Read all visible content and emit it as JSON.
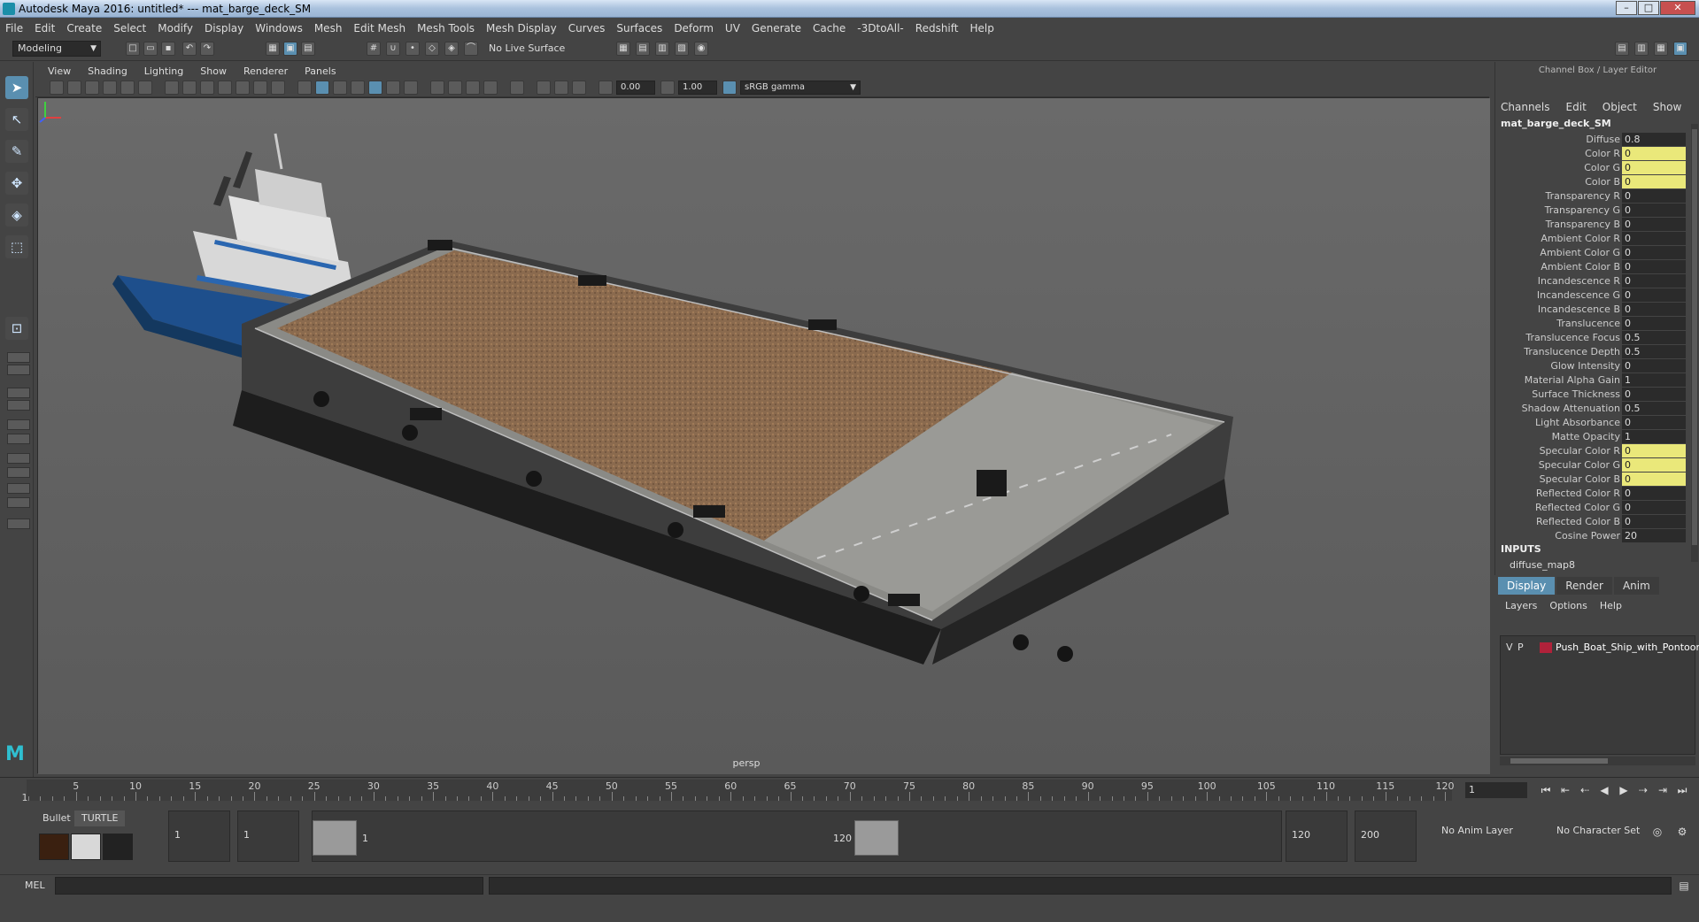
{
  "window": {
    "title": "Autodesk Maya 2016: untitled*   ---   mat_barge_deck_SM"
  },
  "menubar": [
    "File",
    "Edit",
    "Create",
    "Select",
    "Modify",
    "Display",
    "Windows",
    "Mesh",
    "Edit Mesh",
    "Mesh Tools",
    "Mesh Display",
    "Curves",
    "Surfaces",
    "Deform",
    "UV",
    "Generate",
    "Cache",
    "-3DtoAll-",
    "Redshift",
    "Help"
  ],
  "status_line": {
    "mode": "Modeling",
    "live_surface": "No Live Surface"
  },
  "panel_menu": [
    "View",
    "Shading",
    "Lighting",
    "Show",
    "Renderer",
    "Panels"
  ],
  "view_toolbar": {
    "exposure": "0.00",
    "gamma": "1.00",
    "colorspace": "sRGB gamma"
  },
  "viewport": {
    "camera": "persp"
  },
  "channel_box": {
    "header": "Channel Box / Layer Editor",
    "menu": [
      "Channels",
      "Edit",
      "Object",
      "Show"
    ],
    "object_name": "mat_barge_deck_SM",
    "attributes": [
      {
        "label": "Diffuse",
        "value": "0.8",
        "hl": false
      },
      {
        "label": "Color R",
        "value": "0",
        "hl": true
      },
      {
        "label": "Color G",
        "value": "0",
        "hl": true
      },
      {
        "label": "Color B",
        "value": "0",
        "hl": true
      },
      {
        "label": "Transparency R",
        "value": "0",
        "hl": false
      },
      {
        "label": "Transparency G",
        "value": "0",
        "hl": false
      },
      {
        "label": "Transparency B",
        "value": "0",
        "hl": false
      },
      {
        "label": "Ambient Color R",
        "value": "0",
        "hl": false
      },
      {
        "label": "Ambient Color G",
        "value": "0",
        "hl": false
      },
      {
        "label": "Ambient Color B",
        "value": "0",
        "hl": false
      },
      {
        "label": "Incandescence R",
        "value": "0",
        "hl": false
      },
      {
        "label": "Incandescence G",
        "value": "0",
        "hl": false
      },
      {
        "label": "Incandescence B",
        "value": "0",
        "hl": false
      },
      {
        "label": "Translucence",
        "value": "0",
        "hl": false
      },
      {
        "label": "Translucence Focus",
        "value": "0.5",
        "hl": false
      },
      {
        "label": "Translucence Depth",
        "value": "0.5",
        "hl": false
      },
      {
        "label": "Glow Intensity",
        "value": "0",
        "hl": false
      },
      {
        "label": "Material Alpha Gain",
        "value": "1",
        "hl": false
      },
      {
        "label": "Surface Thickness",
        "value": "0",
        "hl": false
      },
      {
        "label": "Shadow Attenuation",
        "value": "0.5",
        "hl": false
      },
      {
        "label": "Light Absorbance",
        "value": "0",
        "hl": false
      },
      {
        "label": "Matte Opacity",
        "value": "1",
        "hl": false
      },
      {
        "label": "Specular Color R",
        "value": "0",
        "hl": true
      },
      {
        "label": "Specular Color G",
        "value": "0",
        "hl": true
      },
      {
        "label": "Specular Color B",
        "value": "0",
        "hl": true
      },
      {
        "label": "Reflected Color R",
        "value": "0",
        "hl": false
      },
      {
        "label": "Reflected Color G",
        "value": "0",
        "hl": false
      },
      {
        "label": "Reflected Color B",
        "value": "0",
        "hl": false
      },
      {
        "label": "Cosine Power",
        "value": "20",
        "hl": false
      }
    ],
    "inputs_label": "INPUTS",
    "inputs": [
      "diffuse_map8"
    ]
  },
  "layer_editor": {
    "tabs": [
      "Display",
      "Render",
      "Anim"
    ],
    "active_tab": "Display",
    "menu": [
      "Layers",
      "Options",
      "Help"
    ],
    "layers": [
      {
        "v": "V",
        "p": "P",
        "name": "Push_Boat_Ship_with_Pontoon",
        "color": "#b0223a"
      }
    ]
  },
  "time_slider": {
    "ticks": [
      "5",
      "10",
      "15",
      "20",
      "25",
      "30",
      "35",
      "40",
      "45",
      "50",
      "55",
      "60",
      "65",
      "70",
      "75",
      "80",
      "85",
      "90",
      "95",
      "100",
      "105",
      "110",
      "115",
      "120"
    ],
    "start_marker": "1",
    "current_frame": "1"
  },
  "range_slider": {
    "shelf_tabs": [
      "Bullet",
      "TURTLE"
    ],
    "start": "1",
    "playback_start": "1",
    "range_start_label": "1",
    "range_end_label": "120",
    "playback_end": "120",
    "end": "200",
    "anim_layer": "No Anim Layer",
    "character_set": "No Character Set"
  },
  "command_line": {
    "label": "MEL"
  },
  "icons": [
    "select-tool-icon",
    "lasso-icon",
    "paint-icon",
    "move-icon",
    "rotate-icon",
    "scale-icon",
    "play-icon",
    "step-forward-icon",
    "step-back-icon",
    "key-first-icon",
    "key-last-icon"
  ]
}
